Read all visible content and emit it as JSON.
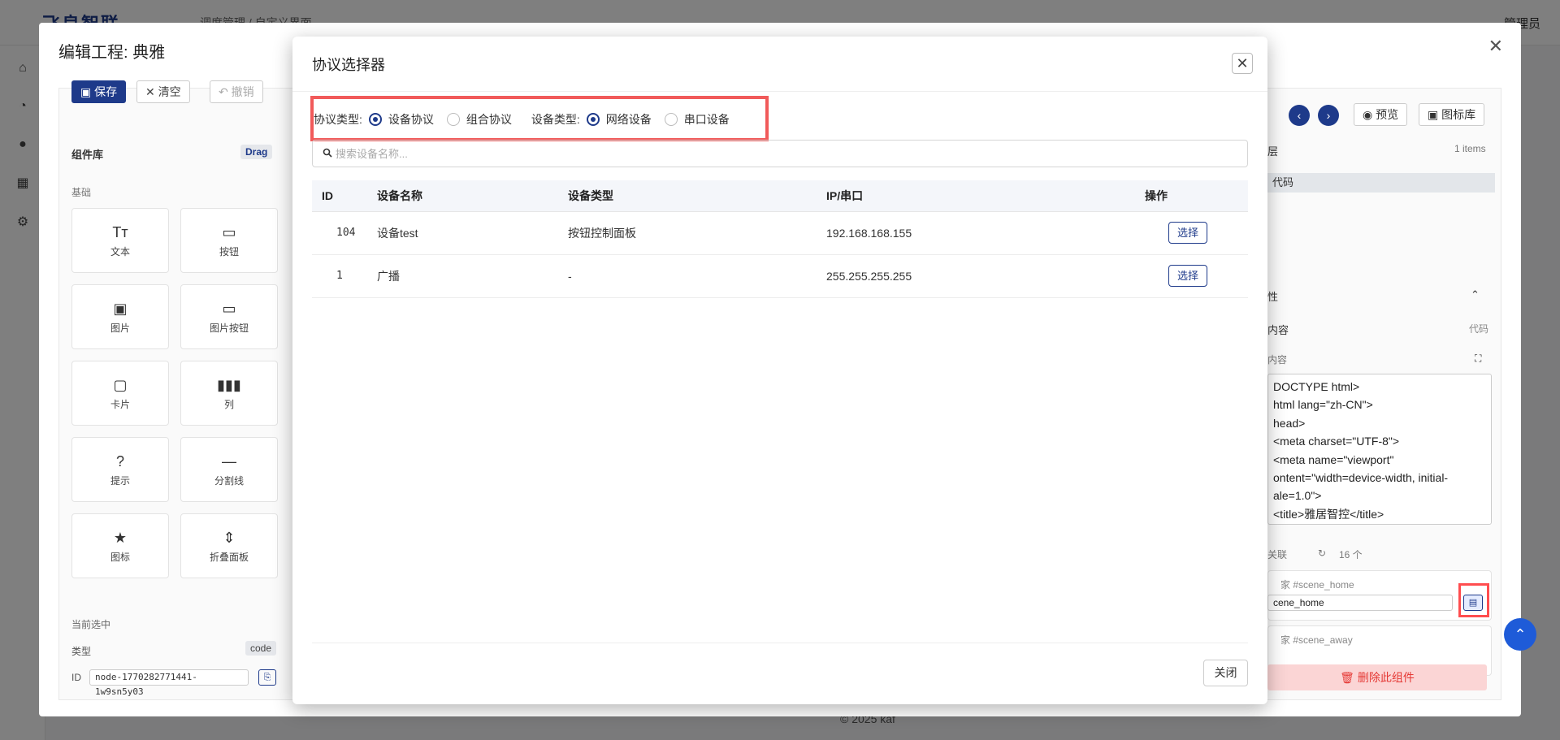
{
  "app": {
    "brand": "飞良智联",
    "breadcrumb": [
      "调度管理",
      "/",
      "自定义界面"
    ],
    "user": "管理员",
    "footer": "© 2025 kaf"
  },
  "editor": {
    "title": "编辑工程: 典雅",
    "toolbar": {
      "save": "保存",
      "clear": "清空",
      "undo": "撤销",
      "preview": "预览",
      "icon_lib": "图标库"
    },
    "library": {
      "title": "组件库",
      "drag_badge": "Drag",
      "group": "基础",
      "components": [
        "文本",
        "按钮",
        "图片",
        "图片按钮",
        "卡片",
        "列",
        "提示",
        "分割线",
        "图标",
        "折叠面板"
      ]
    },
    "current": {
      "title": "当前选中",
      "type_label": "类型",
      "type_value": "code",
      "id_label": "ID",
      "id_value": "node-1770282771441-1w9sn5y03"
    },
    "right": {
      "layer_label": "层",
      "items_count": "1 items",
      "code_item": "代码",
      "props_label": "性",
      "content_label": "内容",
      "content_mode": "代码",
      "content_sub": "内容",
      "code_lines": [
        "DOCTYPE html>",
        "html lang=\"zh-CN\">",
        "head>",
        "<meta charset=\"UTF-8\">",
        "<meta name=\"viewport\"",
        "ontent=\"width=device-width, initial-",
        "ale=1.0\">",
        "<title>雅居智控</title>"
      ],
      "link_label": "关联",
      "link_count": "16 个",
      "scene1_hint": "家  #scene_home",
      "scene1_value": "cene_home",
      "scene2_hint": "家  #scene_away",
      "delete": "删除此组件"
    }
  },
  "dialog": {
    "title": "协议选择器",
    "protocol_type_label": "协议类型:",
    "protocol_options": [
      {
        "label": "设备协议",
        "selected": true
      },
      {
        "label": "组合协议",
        "selected": false
      }
    ],
    "device_type_label": "设备类型:",
    "device_options": [
      {
        "label": "网络设备",
        "selected": true
      },
      {
        "label": "串口设备",
        "selected": false
      }
    ],
    "search_placeholder": "搜索设备名称...",
    "columns": [
      "ID",
      "设备名称",
      "设备类型",
      "IP/串口",
      "操作"
    ],
    "rows": [
      {
        "id": "104",
        "name": "设备test",
        "type": "按钮控制面板",
        "ip": "192.168.168.155",
        "action": "选择"
      },
      {
        "id": "1",
        "name": "广播",
        "type": "-",
        "ip": "255.255.255.255",
        "action": "选择"
      }
    ],
    "close": "关闭"
  },
  "colors": {
    "primary": "#1e3a8a",
    "highlight": "#f15a5a",
    "overlay": "rgba(0,0,0,0.5)"
  }
}
